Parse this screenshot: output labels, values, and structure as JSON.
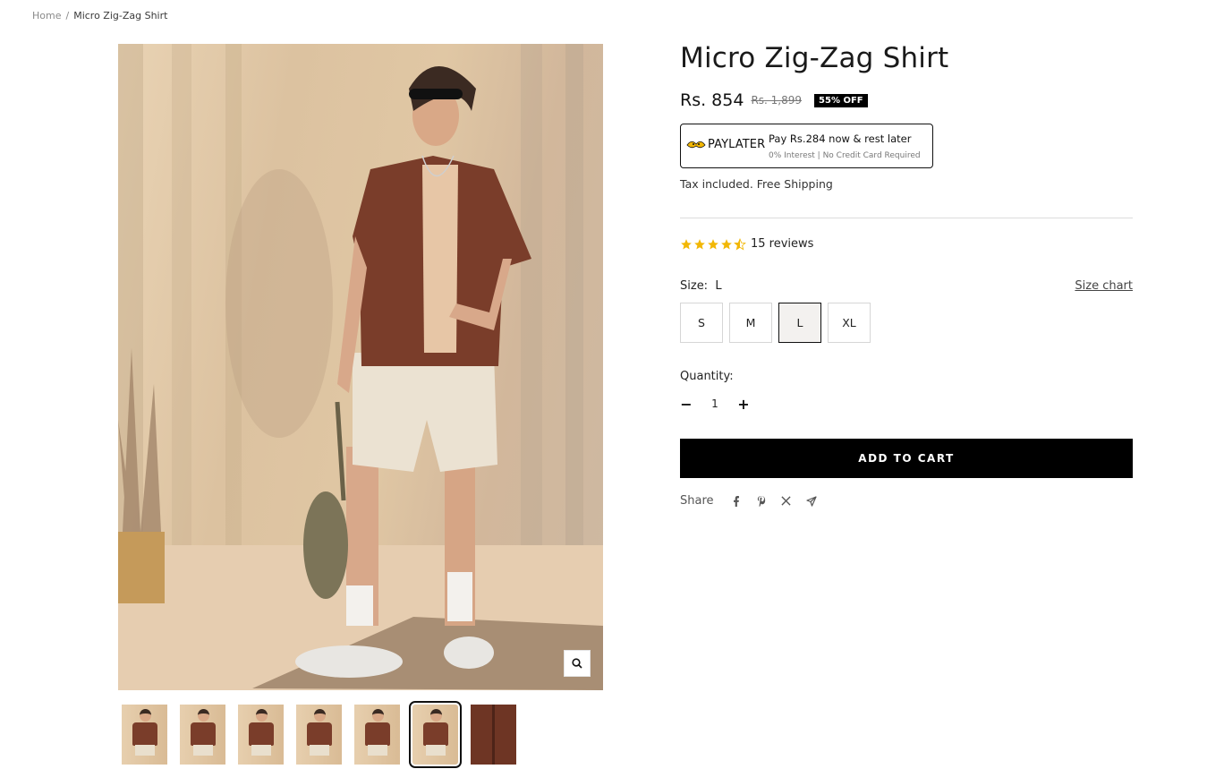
{
  "breadcrumb": {
    "home": "Home",
    "separator": "/",
    "current": "Micro Zig-Zag Shirt"
  },
  "product": {
    "title": "Micro Zig-Zag Shirt",
    "price": "Rs. 854",
    "compare_price": "Rs. 1,899",
    "discount_badge": "55% OFF",
    "tax_note": "Tax included. Free Shipping"
  },
  "paylater": {
    "brand": "PAYLATER",
    "message": "Pay Rs.284 now & rest later",
    "subtext": "0% Interest | No Credit Card Required"
  },
  "rating": {
    "value": 4.5,
    "reviews_label": "15 reviews",
    "star_color": "#f2b705"
  },
  "size": {
    "label": "Size:",
    "selected": "L",
    "chart_link": "Size chart",
    "options": [
      "S",
      "M",
      "L",
      "XL"
    ]
  },
  "quantity": {
    "label": "Quantity:",
    "value": "1",
    "minus": "−",
    "plus": "+"
  },
  "cart": {
    "add_label": "ADD TO CART"
  },
  "share": {
    "label": "Share",
    "icons": [
      "facebook-icon",
      "pinterest-icon",
      "x-icon",
      "telegram-icon"
    ]
  },
  "gallery": {
    "thumbnail_count": 7,
    "active_thumbnail": 6
  },
  "colors": {
    "accent": "#000000",
    "shirt": "#7a3d2a",
    "background": "#e3cbab"
  }
}
